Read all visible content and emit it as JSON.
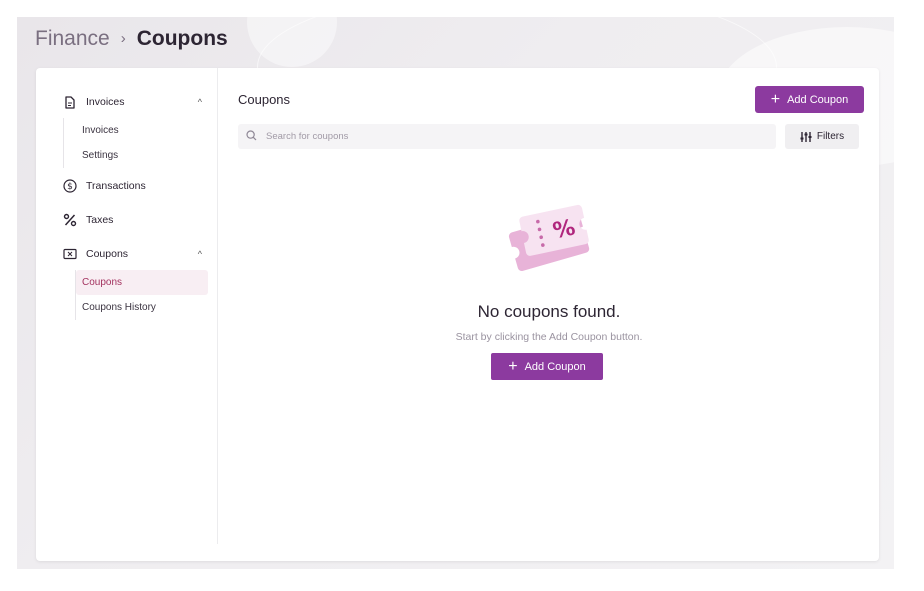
{
  "breadcrumb": {
    "parent": "Finance",
    "separator": "›",
    "current": "Coupons"
  },
  "sidebar": {
    "invoices": {
      "label": "Invoices",
      "icon": "document-icon",
      "expanded": true,
      "items": [
        {
          "label": "Invoices"
        },
        {
          "label": "Settings"
        }
      ]
    },
    "transactions": {
      "label": "Transactions",
      "icon": "dollar-circle-icon"
    },
    "taxes": {
      "label": "Taxes",
      "icon": "percent-icon"
    },
    "coupons": {
      "label": "Coupons",
      "icon": "ticket-icon",
      "expanded": true,
      "items": [
        {
          "label": "Coupons",
          "active": true
        },
        {
          "label": "Coupons History"
        }
      ]
    }
  },
  "main": {
    "title": "Coupons",
    "add_button_label": "Add Coupon",
    "search": {
      "placeholder": "Search for coupons",
      "value": ""
    },
    "filters_label": "Filters",
    "empty": {
      "title": "No coupons found.",
      "subtitle": "Start by clicking the Add Coupon button.",
      "button_label": "Add Coupon",
      "illustration": "coupon-percent-illustration"
    }
  },
  "colors": {
    "accent": "#8c3a9f",
    "active_text": "#a3325f",
    "active_bg": "#f8eef3",
    "coupon_pink": "#e5a3cf"
  }
}
